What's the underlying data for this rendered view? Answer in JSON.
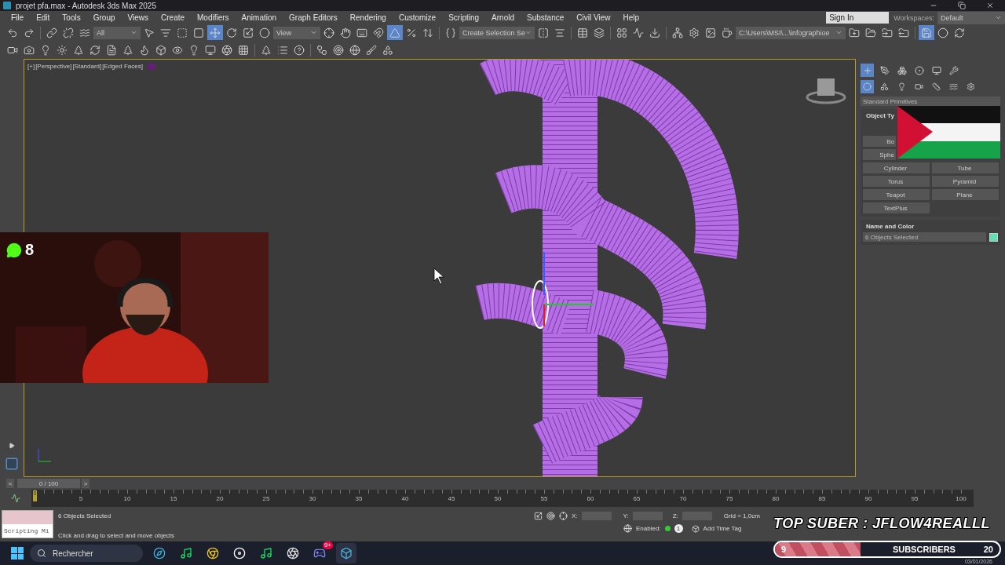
{
  "title_bar": {
    "title": "projet pfa.max - Autodesk 3ds Max 2025"
  },
  "menu": [
    "File",
    "Edit",
    "Tools",
    "Group",
    "Views",
    "Create",
    "Modifiers",
    "Animation",
    "Graph Editors",
    "Rendering",
    "Customize",
    "Scripting",
    "Arnold",
    "Substance",
    "Civil View",
    "Help"
  ],
  "account": {
    "sign_in": "Sign In",
    "workspaces_label": "Workspaces:",
    "workspace": "Default"
  },
  "toolbar_1": [
    {
      "kind": "tool",
      "selected": false
    },
    {
      "kind": "tool",
      "selected": false
    },
    {
      "kind": "separator"
    },
    {
      "kind": "tool",
      "selected": false
    },
    {
      "kind": "tool",
      "selected": false
    },
    {
      "kind": "tool",
      "selected": false
    },
    {
      "kind": "dropdown",
      "value": "All"
    },
    {
      "kind": "tool",
      "selected": false
    },
    {
      "kind": "tool",
      "selected": false
    },
    {
      "kind": "tool",
      "selected": false
    },
    {
      "kind": "tool",
      "selected": false
    },
    {
      "kind": "tool",
      "selected": true
    },
    {
      "kind": "tool",
      "selected": false
    },
    {
      "kind": "tool",
      "selected": false
    },
    {
      "kind": "tool",
      "selected": false
    },
    {
      "kind": "dropdown",
      "value": "View"
    },
    {
      "kind": "tool",
      "selected": false
    },
    {
      "kind": "tool",
      "selected": false
    },
    {
      "kind": "tool",
      "selected": false
    },
    {
      "kind": "tool",
      "selected": false
    },
    {
      "kind": "tool",
      "selected": true
    },
    {
      "kind": "tool",
      "selected": false
    },
    {
      "kind": "tool",
      "selected": false
    },
    {
      "kind": "separator"
    },
    {
      "kind": "tool",
      "selected": false
    },
    {
      "kind": "dropdown",
      "value": "Create Selection Se"
    },
    {
      "kind": "tool",
      "selected": false
    },
    {
      "kind": "tool",
      "selected": false
    },
    {
      "kind": "separator"
    },
    {
      "kind": "tool",
      "selected": false
    },
    {
      "kind": "tool",
      "selected": false
    },
    {
      "kind": "separator"
    },
    {
      "kind": "tool",
      "selected": false
    },
    {
      "kind": "tool",
      "selected": false
    },
    {
      "kind": "tool",
      "selected": false
    },
    {
      "kind": "separator"
    },
    {
      "kind": "tool",
      "selected": false
    },
    {
      "kind": "tool",
      "selected": false
    },
    {
      "kind": "tool",
      "selected": false
    },
    {
      "kind": "tool",
      "selected": false
    },
    {
      "kind": "dropdown",
      "value": "C:\\Users\\MSI\\...\\infographioe"
    },
    {
      "kind": "tool",
      "selected": false
    },
    {
      "kind": "tool",
      "selected": false
    },
    {
      "kind": "tool",
      "selected": false
    },
    {
      "kind": "tool",
      "selected": false
    },
    {
      "kind": "separator"
    },
    {
      "kind": "tool",
      "selected": true
    },
    {
      "kind": "tool",
      "selected": false
    },
    {
      "kind": "tool",
      "selected": false
    }
  ],
  "toolbar_2": [
    {
      "kind": "tool",
      "selected": false
    },
    {
      "kind": "tool",
      "selected": false
    },
    {
      "kind": "tool",
      "selected": false
    },
    {
      "kind": "tool",
      "selected": false
    },
    {
      "kind": "tool",
      "selected": false
    },
    {
      "kind": "tool",
      "selected": false
    },
    {
      "kind": "tool",
      "selected": false
    },
    {
      "kind": "tool",
      "selected": false
    },
    {
      "kind": "tool",
      "selected": false
    },
    {
      "kind": "tool",
      "selected": false
    },
    {
      "kind": "tool",
      "selected": false
    },
    {
      "kind": "tool",
      "selected": false
    },
    {
      "kind": "tool",
      "selected": false
    },
    {
      "kind": "tool",
      "selected": false
    },
    {
      "kind": "tool",
      "selected": false
    },
    {
      "kind": "separator"
    },
    {
      "kind": "tool",
      "selected": false
    },
    {
      "kind": "tool",
      "selected": false
    },
    {
      "kind": "tool",
      "selected": false
    },
    {
      "kind": "separator"
    },
    {
      "kind": "tool",
      "selected": false
    },
    {
      "kind": "tool",
      "selected": false
    },
    {
      "kind": "tool",
      "selected": false
    },
    {
      "kind": "tool",
      "selected": false
    },
    {
      "kind": "tool",
      "selected": false
    }
  ],
  "viewport": {
    "labels": [
      "[+]",
      "[Perspective]",
      "[Standard]",
      "[Edged Faces]"
    ]
  },
  "stream_overlay": {
    "viewer_count": "8",
    "banner": "TOP SUBER : JFLOW4REALLL",
    "subscribers": {
      "count": "9",
      "label": "SUBSCRIBERS",
      "goal": "20",
      "level": 0.38
    }
  },
  "command_panel": {
    "tabs": [
      {
        "selected": true
      },
      {
        "selected": false
      },
      {
        "selected": false
      },
      {
        "selected": false
      },
      {
        "selected": false
      },
      {
        "selected": false
      }
    ],
    "subtabs": [
      {
        "selected": true
      },
      {
        "selected": false
      },
      {
        "selected": false
      },
      {
        "selected": false
      },
      {
        "selected": false
      },
      {
        "selected": false
      },
      {
        "selected": false
      }
    ],
    "category": "Standard Primitives",
    "object_type": {
      "title": "Object Ty",
      "rows": [
        [
          "Bo"
        ],
        [
          "Sphe"
        ],
        [
          "Cylinder",
          "Tube"
        ],
        [
          "Torus",
          "Pyramid"
        ],
        [
          "Teapot",
          "Plane"
        ],
        [
          "TextPlus"
        ]
      ]
    },
    "name_and_color": {
      "title": "Name and Color",
      "name": "6 Objects Selected",
      "color": "#5fe0b8"
    }
  },
  "time_slider": {
    "frame": "0 / 100",
    "prev": "<",
    "next": ">",
    "level": 0,
    "marker": "0",
    "ticks": [
      "5",
      "10",
      "15",
      "20",
      "25",
      "30",
      "35",
      "40",
      "45",
      "50",
      "55",
      "60",
      "65",
      "70",
      "75",
      "80",
      "85",
      "90",
      "95",
      "100"
    ]
  },
  "status": {
    "script_listener": "Scripting Mi",
    "selection": "6 Objects Selected",
    "prompt": "Click and drag to select and move objects",
    "x": "X:",
    "y": "Y:",
    "z": "Z:",
    "grid": "Grid = 1,0cm",
    "enabled": "Enabled:",
    "enabled_on": true,
    "layer": "1",
    "time_tag": "Add Time Tag"
  },
  "taskbar": {
    "search_placeholder": "Rechercher",
    "apps": [
      {
        "selected": false
      },
      {
        "selected": false
      },
      {
        "selected": false
      },
      {
        "selected": false
      },
      {
        "selected": false
      },
      {
        "selected": false
      },
      {
        "selected": false,
        "badge": "9+"
      },
      {
        "selected": true
      }
    ],
    "date": "03/01/2026"
  }
}
